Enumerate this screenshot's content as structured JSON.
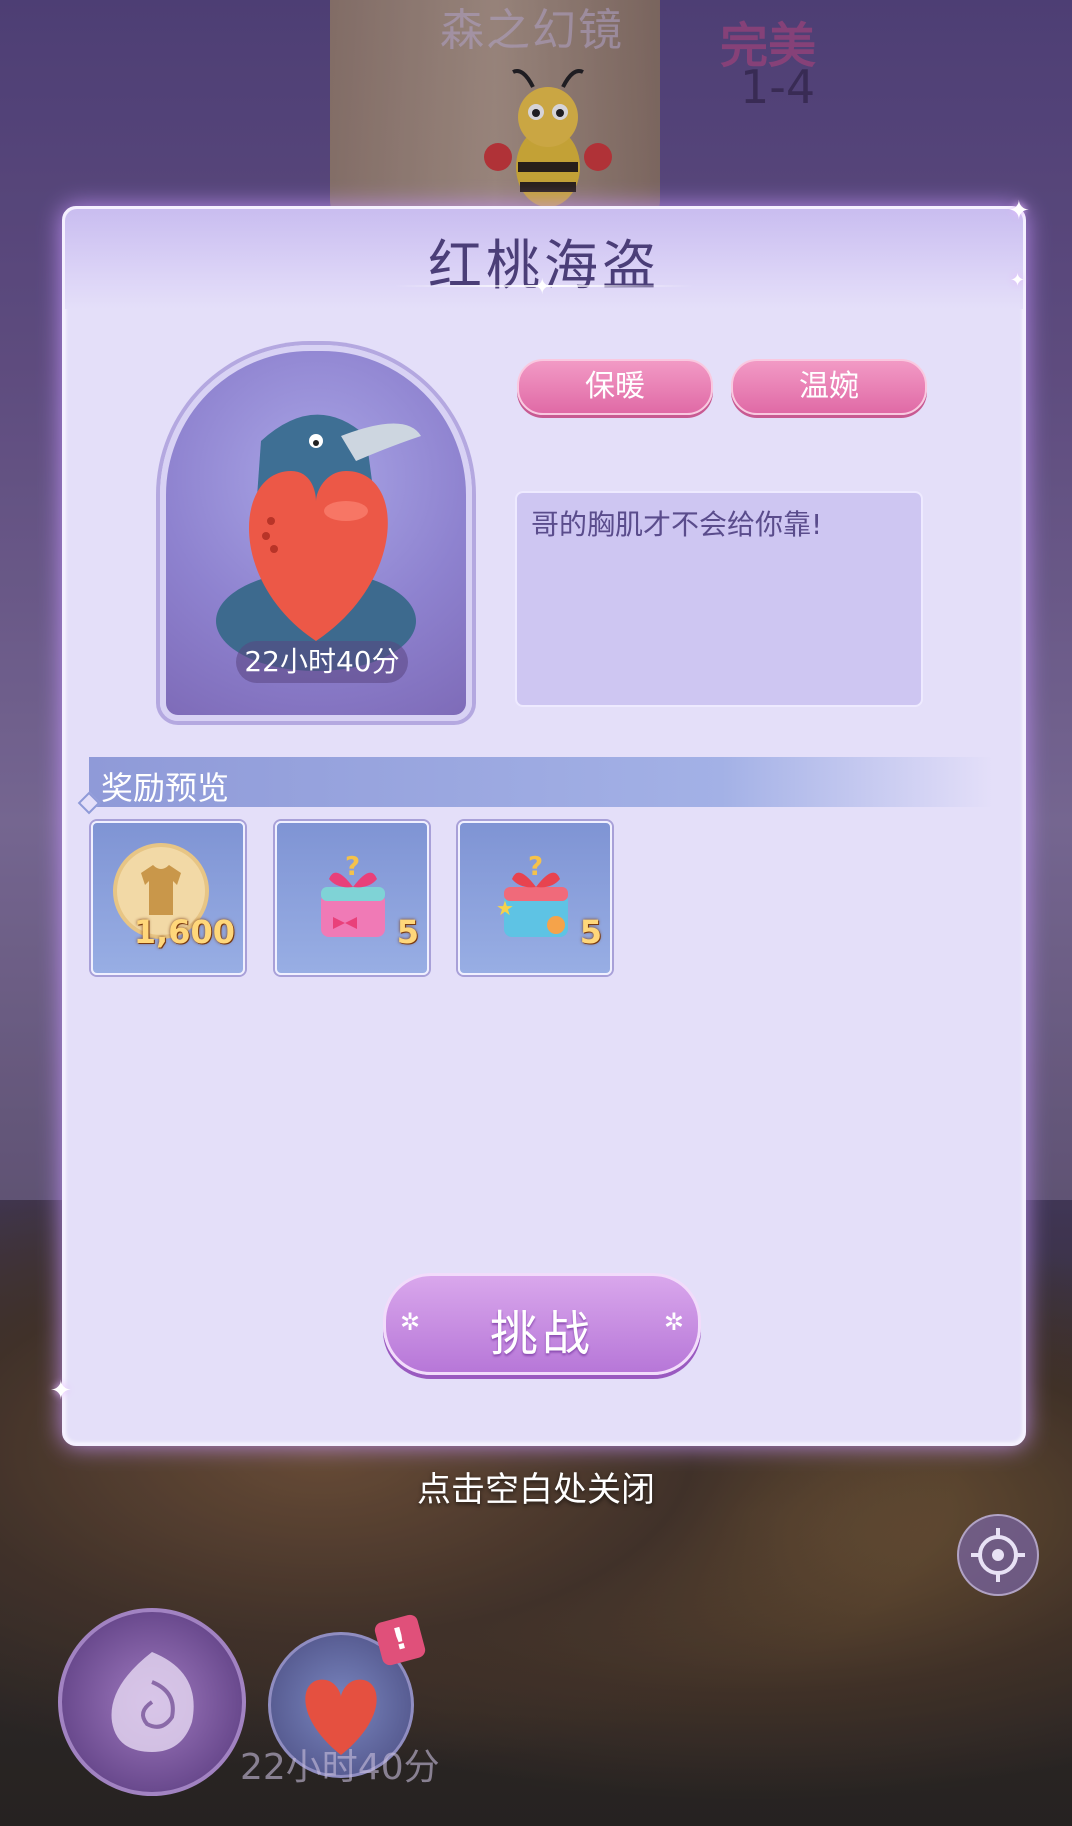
{
  "background": {
    "level_name": "森之幻镜",
    "grade": "完美",
    "stage": "1-4",
    "close_hint": "点击空白处关闭",
    "mini_timer": "22小时40分",
    "alert_mark": "!"
  },
  "dialog": {
    "title": "红桃海盗",
    "timer": "22小时40分",
    "tags": [
      "保暖",
      "温婉"
    ],
    "quote": "哥的胸肌才不会给你靠!",
    "reward_section_label": "奖励预览",
    "rewards": [
      {
        "icon": "clothing-coin-icon",
        "count": "1,600"
      },
      {
        "icon": "pink-gift-box-icon",
        "count": "5"
      },
      {
        "icon": "blue-gift-box-icon",
        "count": "5"
      }
    ],
    "challenge_label": "挑战"
  },
  "colors": {
    "dialog_bg": "#e4dff9",
    "title": "#4b3e78",
    "tag": "#e06aa6",
    "button": "#b777d8",
    "reward_tile": "#8fa3dc"
  }
}
